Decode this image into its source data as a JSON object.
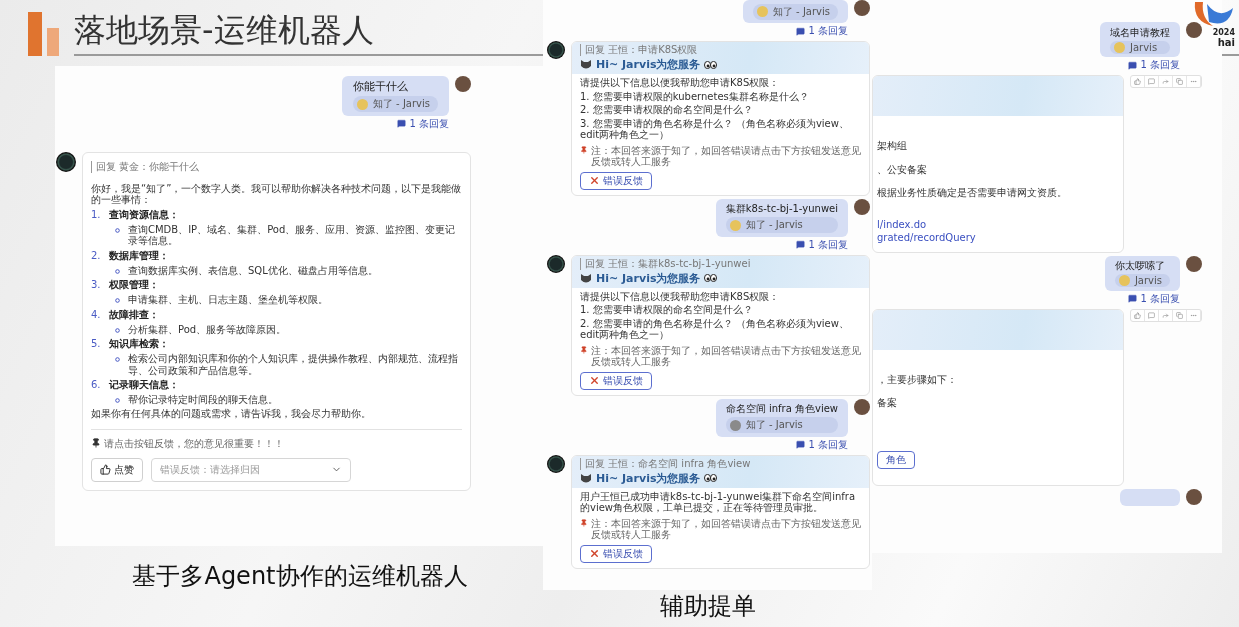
{
  "slide": {
    "title": "落地场景-运维机器人",
    "logo_year": "2024",
    "logo_text": "hai"
  },
  "left_chat": {
    "user_message": {
      "text": "你能干什么",
      "chip": "知了 - Jarvis",
      "replies": "1 条回复"
    },
    "bot_reply": {
      "quote": "回复 黄金：你能干什么",
      "intro": "你好，我是“知了”，一个数字人类。我可以帮助你解决各种技术问题，以下是我能做的一些事情：",
      "items": [
        {
          "number": "1.",
          "title": "查询资源信息：",
          "detail": "查询CMDB、IP、域名、集群、Pod、服务、应用、资源、监控图、变更记录等信息。"
        },
        {
          "number": "2.",
          "title": "数据库管理：",
          "detail": "查询数据库实例、表信息、SQL优化、磁盘占用等信息。"
        },
        {
          "number": "3.",
          "title": "权限管理：",
          "detail": "申请集群、主机、日志主题、堡垒机等权限。"
        },
        {
          "number": "4.",
          "title": "故障排查：",
          "detail": "分析集群、Pod、服务等故障原因。"
        },
        {
          "number": "5.",
          "title": "知识库检索：",
          "detail": "检索公司内部知识库和你的个人知识库，提供操作教程、内部规范、流程指导、公司政策和产品信息等。"
        },
        {
          "number": "6.",
          "title": "记录聊天信息：",
          "detail": "帮你记录特定时间段的聊天信息。"
        }
      ],
      "outro": "如果你有任何具体的问题或需求，请告诉我，我会尽力帮助你。",
      "feedback_note": "请点击按钮反馈，您的意见很重要！！！",
      "like_button": "点赞",
      "feedback_select": {
        "placeholder": "错误反馈：请选择归因"
      }
    },
    "caption": "基于多Agent协作的运维机器人"
  },
  "middle_chat": {
    "messages": [
      {
        "kind": "user",
        "chip": "知了 - Jarvis",
        "replies": "1 条回复"
      },
      {
        "kind": "bot",
        "quote": "回复 王恒：申请K8S权限",
        "title": "Hi~ Jarvis为您服务",
        "lines": [
          "请提供以下信息以便我帮助您申请K8S权限：",
          "1. 您需要申请权限的kubernetes集群名称是什么？",
          "2. 您需要申请权限的命名空间是什么？",
          "3. 您需要申请的角色名称是什么？ （角色名称必须为view、edit两种角色之一）"
        ],
        "note": "注：本回答来源于知了，如回答错误请点击下方按钮发送意见反馈或转人工服务",
        "button": "错误反馈"
      },
      {
        "kind": "user",
        "text": "集群k8s-tc-bj-1-yunwei",
        "chip": "知了 - Jarvis",
        "replies": "1 条回复"
      },
      {
        "kind": "bot",
        "quote": "回复 王恒：集群k8s-tc-bj-1-yunwei",
        "title": "Hi~ Jarvis为您服务",
        "lines": [
          "请提供以下信息以便我帮助您申请K8S权限：",
          "1. 您需要申请权限的命名空间是什么？",
          "2. 您需要申请的角色名称是什么？ （角色名称必须为view、edit两种角色之一）"
        ],
        "note": "注：本回答来源于知了，如回答错误请点击下方按钮发送意见反馈或转人工服务",
        "button": "错误反馈"
      },
      {
        "kind": "user",
        "text": "命名空间 infra 角色view",
        "chip": "知了 - Jarvis",
        "replies": "1 条回复"
      },
      {
        "kind": "bot",
        "quote": "回复 王恒：命名空间 infra 角色view",
        "title": "Hi~ Jarvis为您服务",
        "lines": [
          "用户王恒已成功申请k8s-tc-bj-1-yunwei集群下命名空间infra的view角色权限，工单已提交，正在等待管理员审批。"
        ],
        "note": "注：本回答来源于知了，如回答错误请点击下方按钮发送意见反馈或转人工服务",
        "button": "错误反馈"
      }
    ],
    "caption": "辅助提单"
  },
  "right_chat": {
    "messages": [
      {
        "kind": "user",
        "text": "域名申请教程",
        "chip": "Jarvis",
        "replies": "1 条回复"
      },
      {
        "kind": "bot",
        "lines": [
          "架构组",
          "、公安备案",
          "根据业务性质确定是否需要申请网文资质。"
        ],
        "links": [
          "l/index.do",
          "grated/recordQuery"
        ]
      },
      {
        "kind": "user",
        "text": "你太啰嗦了",
        "chip": "Jarvis",
        "replies": "1 条回复"
      },
      {
        "kind": "bot",
        "lines": [
          "，主要步骤如下：",
          "备案"
        ],
        "button": "角色"
      },
      {
        "kind": "user"
      }
    ]
  }
}
